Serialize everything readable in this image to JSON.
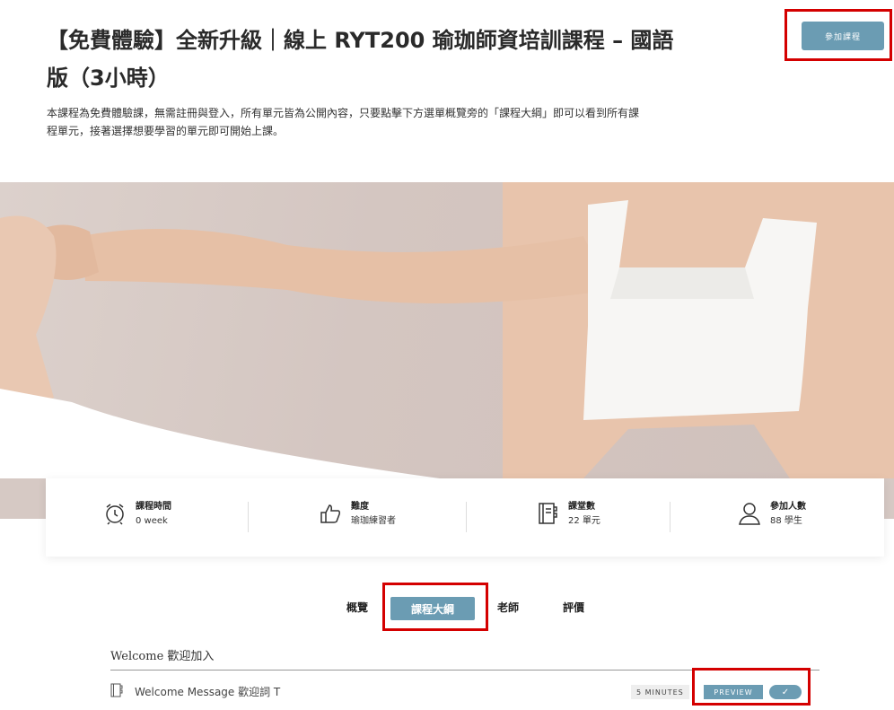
{
  "course": {
    "title": "【免費體驗】全新升級｜線上 RYT200 瑜珈師資培訓課程 – 國語版（3小時）",
    "description": "本課程為免費體驗課，無需註冊與登入，所有單元皆為公開內容，只要點擊下方選單概覽旁的「課程大綱」即可以看到所有課程單元，接著選擇想要學習的單元即可開始上課。",
    "join_label": "參加課程"
  },
  "stats": [
    {
      "label": "課程時間",
      "value": "0 week",
      "icon": "alarm-clock-icon"
    },
    {
      "label": "難度",
      "value": "瑜珈練習者",
      "icon": "thumbs-up-icon"
    },
    {
      "label": "課堂數",
      "value": "22 單元",
      "icon": "notebook-icon"
    },
    {
      "label": "參加人數",
      "value": "88 學生",
      "icon": "user-icon"
    }
  ],
  "tabs": {
    "overview": "概覽",
    "curriculum": "課程大綱",
    "instructor": "老師",
    "reviews": "評價"
  },
  "curriculum": {
    "section_title": "Welcome 歡迎加入",
    "lesson": {
      "title": "Welcome Message 歡迎詞 T",
      "duration": "5 MINUTES",
      "preview_label": "PREVIEW",
      "check_glyph": "✓"
    }
  },
  "colors": {
    "accent": "#6b9cb3",
    "highlight_border": "#d40000"
  }
}
